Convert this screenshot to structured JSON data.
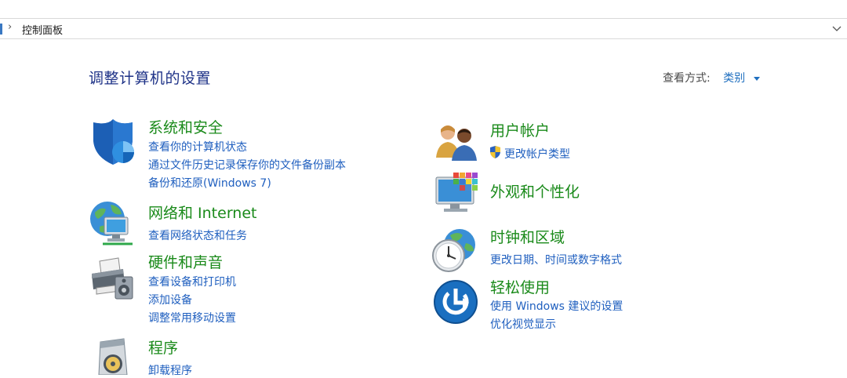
{
  "address_bar": {
    "breadcrumb": "控制面板"
  },
  "header": {
    "title": "调整计算机的设置",
    "view_by_label": "查看方式:",
    "view_by_value": "类别"
  },
  "categories_left": [
    {
      "icon": "security-shield-icon",
      "title": "系统和安全",
      "links": [
        "查看你的计算机状态",
        "通过文件历史记录保存你的文件备份副本",
        "备份和还原(Windows 7)"
      ]
    },
    {
      "icon": "network-globe-icon",
      "title": "网络和 Internet",
      "links": [
        "查看网络状态和任务"
      ]
    },
    {
      "icon": "printer-speaker-icon",
      "title": "硬件和声音",
      "links": [
        "查看设备和打印机",
        "添加设备",
        "调整常用移动设置"
      ]
    },
    {
      "icon": "programs-disc-icon",
      "title": "程序",
      "links": [
        "卸载程序"
      ]
    }
  ],
  "categories_right": [
    {
      "icon": "users-icon",
      "title": "用户帐户",
      "links": [
        "更改帐户类型"
      ]
    },
    {
      "icon": "appearance-monitor-icon",
      "title": "外观和个性化",
      "links": []
    },
    {
      "icon": "clock-globe-icon",
      "title": "时钟和区域",
      "links": [
        "更改日期、时间或数字格式"
      ]
    },
    {
      "icon": "ease-of-access-icon",
      "title": "轻松使用",
      "links": [
        "使用 Windows 建议的设置",
        "优化视觉显示"
      ]
    }
  ]
}
